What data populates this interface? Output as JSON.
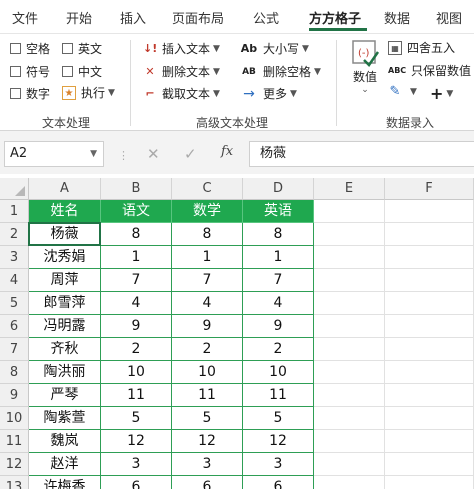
{
  "tabs": [
    "文件",
    "开始",
    "插入",
    "页面布局",
    "公式",
    "方方格子",
    "数据",
    "视图"
  ],
  "active_tab": "方方格子",
  "ribbon": {
    "checkboxes": [
      "空格",
      "英文",
      "符号",
      "中文",
      "数字"
    ],
    "execute": "执行",
    "group1_label": "文本处理",
    "insert_text": "插入文本",
    "delete_text": "删除文本",
    "truncate_text": "截取文本",
    "case": "大小写",
    "delete_space": "删除空格",
    "more": "更多",
    "group2_label": "高级文本处理",
    "value_btn": "数值",
    "round": "四舍五入",
    "keep_value": "只保留数值",
    "group3_label": "数据录入"
  },
  "formula_bar": {
    "name_box": "A2",
    "formula": "杨薇",
    "fx_label": "fx"
  },
  "columns": [
    "A",
    "B",
    "C",
    "D",
    "E",
    "F"
  ],
  "rows": [
    "1",
    "2",
    "3",
    "4",
    "5",
    "6",
    "7",
    "8",
    "9",
    "10",
    "11",
    "12",
    "13"
  ],
  "table": {
    "header": [
      "姓名",
      "语文",
      "数学",
      "英语"
    ],
    "data": [
      [
        "杨薇",
        "8",
        "8",
        "8"
      ],
      [
        "沈秀娟",
        "1",
        "1",
        "1"
      ],
      [
        "周萍",
        "7",
        "7",
        "7"
      ],
      [
        "郎雪萍",
        "4",
        "4",
        "4"
      ],
      [
        "冯明露",
        "9",
        "9",
        "9"
      ],
      [
        "齐秋",
        "2",
        "2",
        "2"
      ],
      [
        "陶洪丽",
        "10",
        "10",
        "10"
      ],
      [
        "严琴",
        "11",
        "11",
        "11"
      ],
      [
        "陶紫萱",
        "5",
        "5",
        "5"
      ],
      [
        "魏岚",
        "12",
        "12",
        "12"
      ],
      [
        "赵洋",
        "3",
        "3",
        "3"
      ],
      [
        "许梅香",
        "6",
        "6",
        "6"
      ]
    ]
  },
  "colors": {
    "accent": "#217346",
    "header_fill": "#1fa84f"
  }
}
